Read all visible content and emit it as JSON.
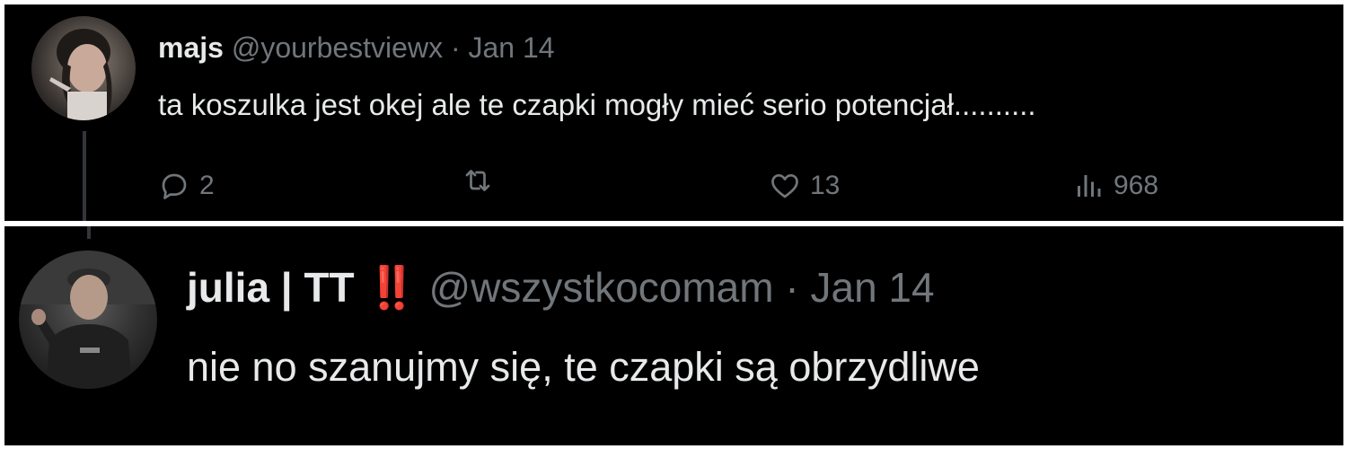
{
  "tweets": [
    {
      "display_name": "majs",
      "handle": "@yourbestviewx",
      "separator": "·",
      "date": "Jan 14",
      "text": "ta koszulka jest okej ale te czapki mogły mieć serio potencjał..........",
      "replies": "2",
      "likes": "13",
      "views": "968"
    },
    {
      "display_name": "julia | TT",
      "emoji": "‼️",
      "handle": "@wszystkocomam",
      "separator": "·",
      "date": "Jan 14",
      "text": "nie no szanujmy się, te czapki są obrzydliwe"
    }
  ],
  "icons": {
    "reply": "reply-icon",
    "retweet": "retweet-icon",
    "like": "heart-icon",
    "views": "views-icon"
  },
  "colors": {
    "background": "#000000",
    "text": "#e7e9ea",
    "muted": "#71767b",
    "emoji_red": "#e0245e"
  }
}
